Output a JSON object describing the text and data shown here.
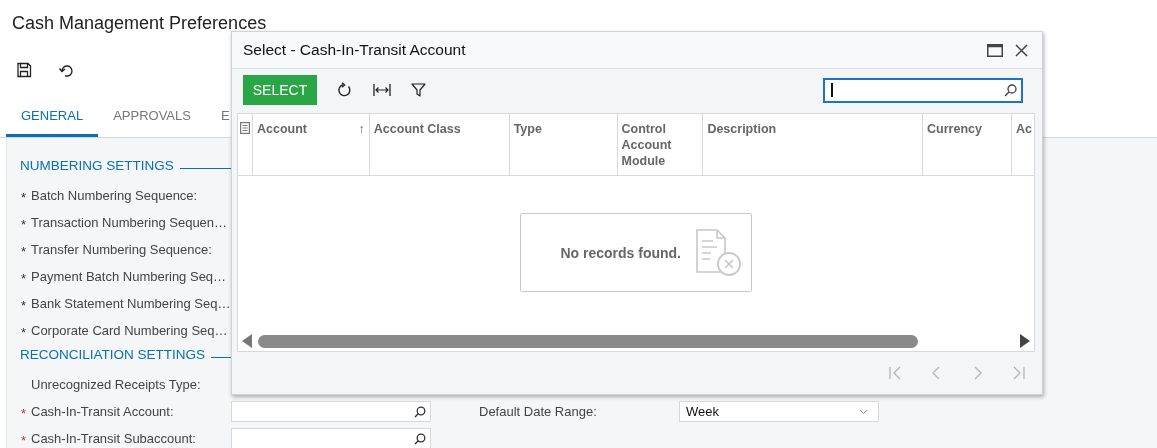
{
  "page": {
    "title": "Cash Management Preferences",
    "tabs": [
      {
        "label": "GENERAL",
        "selected": true
      },
      {
        "label": "APPROVALS",
        "selected": false
      },
      {
        "label": "E",
        "selected": false
      }
    ],
    "sections": [
      {
        "title": "NUMBERING SETTINGS",
        "fields": [
          {
            "label": "Batch Numbering Sequence:",
            "marker": "*",
            "missing": false
          },
          {
            "label": "Transaction Numbering Sequen…",
            "marker": "*",
            "missing": false
          },
          {
            "label": "Transfer Numbering Sequence:",
            "marker": "*",
            "missing": false
          },
          {
            "label": "Payment Batch Numbering Seq…",
            "marker": "*",
            "missing": false
          },
          {
            "label": "Bank Statement Numbering Seq…",
            "marker": "*",
            "missing": false
          },
          {
            "label": "Corporate Card Numbering Seq…",
            "marker": "*",
            "missing": false
          }
        ]
      },
      {
        "title": "RECONCILIATION SETTINGS",
        "fields": [
          {
            "label": "Unrecognized Receipts Type:"
          },
          {
            "label": "Cash-In-Transit Account:",
            "marker": "*",
            "missing": true,
            "input": {
              "kind": "lookup"
            },
            "beside": {
              "label": "Default Date Range:",
              "input": {
                "kind": "select",
                "value": "Week"
              }
            }
          },
          {
            "label": "Cash-In-Transit Subaccount:",
            "marker": "*",
            "missing": true,
            "input": {
              "kind": "lookup"
            }
          }
        ]
      }
    ]
  },
  "dialog": {
    "title": "Select - Cash-In-Transit Account",
    "select_button": "SELECT",
    "search": {
      "focused": true
    },
    "columns": [
      {
        "label": "Account",
        "sort_arrow": "↑"
      },
      {
        "label": "Account Class"
      },
      {
        "label": "Type"
      },
      {
        "label": "Control Account Module"
      },
      {
        "label": "Description"
      },
      {
        "label": "Currency"
      },
      {
        "label": "Ac"
      }
    ],
    "empty_message": "No records found.",
    "pager": {
      "disabled": true
    }
  }
}
